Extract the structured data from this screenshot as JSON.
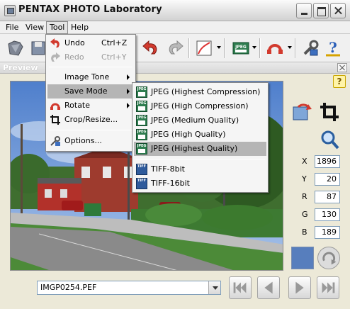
{
  "window": {
    "title": "PENTAX PHOTO Laboratory"
  },
  "menubar": {
    "items": [
      "File",
      "View",
      "Tool",
      "Help"
    ],
    "active": "Tool"
  },
  "tool_menu": {
    "items": [
      {
        "label": "Undo",
        "shortcut": "Ctrl+Z",
        "enabled": true,
        "icon": "undo-icon"
      },
      {
        "label": "Redo",
        "shortcut": "Ctrl+Y",
        "enabled": false,
        "icon": "redo-icon"
      },
      {
        "label": "Image Tone",
        "submenu": true
      },
      {
        "label": "Save Mode",
        "submenu": true,
        "highlighted": true
      },
      {
        "label": "Rotate",
        "submenu": true,
        "icon": "rotate-icon"
      },
      {
        "label": "Crop/Resize...",
        "icon": "crop-icon"
      },
      {
        "label": "Options...",
        "icon": "options-icon"
      }
    ]
  },
  "save_mode_menu": {
    "items": [
      {
        "label": "JPEG (Highest Compression)",
        "icon": "jpeg-icon"
      },
      {
        "label": "JPEG (High Compression)",
        "icon": "jpeg-icon"
      },
      {
        "label": "JPEG (Medium Quality)",
        "icon": "jpeg-icon"
      },
      {
        "label": "JPEG (High Quality)",
        "icon": "jpeg-icon"
      },
      {
        "label": "JPEG (Highest Quality)",
        "icon": "jpeg-icon",
        "highlighted": true
      },
      {
        "label": "TIFF-8bit",
        "icon": "tiff-icon"
      },
      {
        "label": "TIFF-16bit",
        "icon": "tiff-icon"
      }
    ]
  },
  "preview": {
    "title": "Preview",
    "help_label": "?"
  },
  "pixel_readout": {
    "x_label": "X",
    "x_value": "1896",
    "y_label": "Y",
    "y_value": "20",
    "r_label": "R",
    "r_value": "87",
    "g_label": "G",
    "g_value": "130",
    "b_label": "B",
    "b_value": "189"
  },
  "color_swatch": "#577ebd",
  "file_selector": {
    "value": "IMGP0254.PEF"
  },
  "navigation": [
    "first-image-icon",
    "previous-image-icon",
    "next-image-icon",
    "last-image-icon"
  ]
}
